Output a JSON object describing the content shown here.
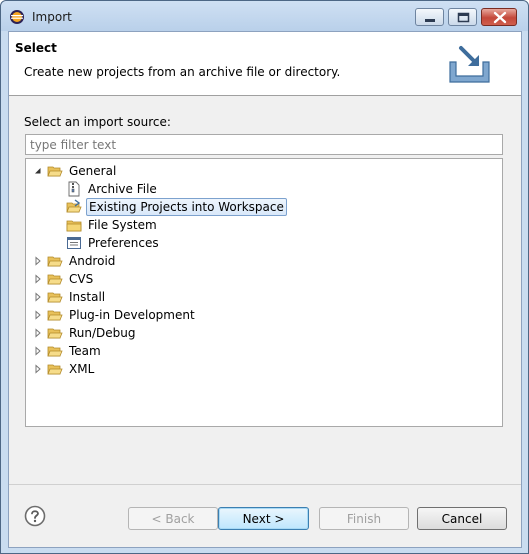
{
  "window": {
    "title": "Import"
  },
  "header": {
    "title": "Select",
    "description": "Create new projects from an archive file or directory."
  },
  "source": {
    "label": "Select an import source:",
    "filter_placeholder": "type filter text",
    "filter_value": ""
  },
  "tree": {
    "items": [
      {
        "label": "General",
        "expanded": true,
        "icon": "folder-open-icon"
      },
      {
        "label": "Archive File",
        "icon": "archive-file-icon"
      },
      {
        "label": "Existing Projects into Workspace",
        "icon": "project-folder-icon",
        "selected": true
      },
      {
        "label": "File System",
        "icon": "folder-icon"
      },
      {
        "label": "Preferences",
        "icon": "preferences-icon"
      },
      {
        "label": "Android",
        "expanded": false,
        "icon": "folder-icon"
      },
      {
        "label": "CVS",
        "expanded": false,
        "icon": "folder-icon"
      },
      {
        "label": "Install",
        "expanded": false,
        "icon": "folder-icon"
      },
      {
        "label": "Plug-in Development",
        "expanded": false,
        "icon": "folder-icon"
      },
      {
        "label": "Run/Debug",
        "expanded": false,
        "icon": "folder-icon"
      },
      {
        "label": "Team",
        "expanded": false,
        "icon": "folder-icon"
      },
      {
        "label": "XML",
        "expanded": false,
        "icon": "folder-icon"
      }
    ]
  },
  "buttons": {
    "back": "< Back",
    "next": "Next >",
    "finish": "Finish",
    "cancel": "Cancel"
  },
  "colors": {
    "accent": "#3c7fb1",
    "selection": "#d9e8f9",
    "folder": "#e8c15a"
  }
}
